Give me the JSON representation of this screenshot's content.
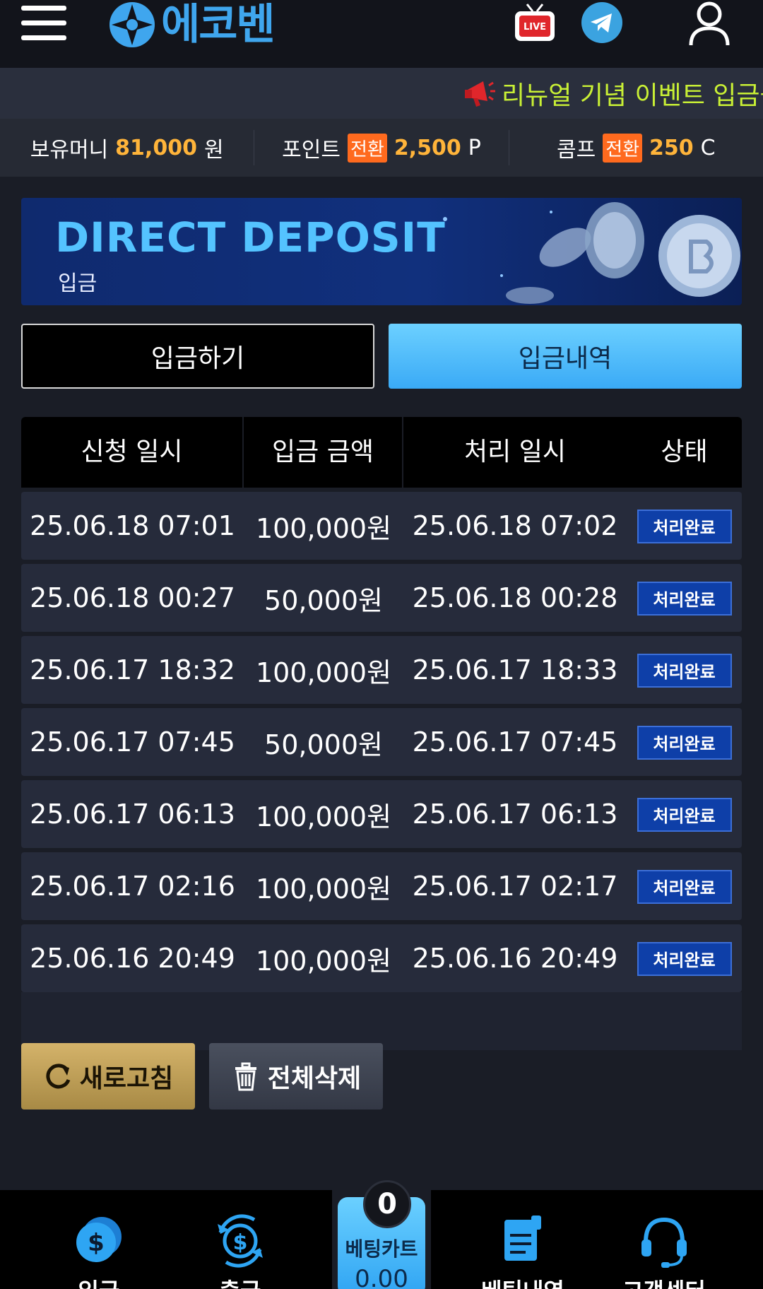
{
  "header": {
    "logo_text": "에코벤",
    "live_label": "LIVE"
  },
  "ticker": {
    "text": "리뉴얼 기념 이벤트 입금플"
  },
  "balance": {
    "money_label": "보유머니",
    "money_value": "81,000",
    "money_unit": "원",
    "point_label": "포인트",
    "point_convert": "전환",
    "point_value": "2,500",
    "point_unit": "P",
    "comp_label": "콤프",
    "comp_convert": "전환",
    "comp_value": "250",
    "comp_unit": "C"
  },
  "banner": {
    "title": "DIRECT DEPOSIT",
    "subtitle": "입금"
  },
  "tabs": {
    "deposit": "입금하기",
    "history": "입금내역"
  },
  "table": {
    "headers": [
      "신청 일시",
      "입금 금액",
      "처리 일시",
      "상태"
    ],
    "rows": [
      {
        "requested": "25.06.18 07:01",
        "amount": "100,000원",
        "processed": "25.06.18 07:02",
        "status": "처리완료"
      },
      {
        "requested": "25.06.18 00:27",
        "amount": "50,000원",
        "processed": "25.06.18 00:28",
        "status": "처리완료"
      },
      {
        "requested": "25.06.17 18:32",
        "amount": "100,000원",
        "processed": "25.06.17 18:33",
        "status": "처리완료"
      },
      {
        "requested": "25.06.17 07:45",
        "amount": "50,000원",
        "processed": "25.06.17 07:45",
        "status": "처리완료"
      },
      {
        "requested": "25.06.17 06:13",
        "amount": "100,000원",
        "processed": "25.06.17 06:13",
        "status": "처리완료"
      },
      {
        "requested": "25.06.17 02:16",
        "amount": "100,000원",
        "processed": "25.06.17 02:17",
        "status": "처리완료"
      },
      {
        "requested": "25.06.16 20:49",
        "amount": "100,000원",
        "processed": "25.06.16 20:49",
        "status": "처리완료"
      }
    ]
  },
  "actions": {
    "refresh": "새로고침",
    "delete_all": "전체삭제"
  },
  "bottom_nav": {
    "deposit": "입금",
    "withdraw": "출금",
    "bet_cart_title": "베팅카트",
    "bet_cart_count": "0",
    "bet_cart_value": "0.00",
    "bet_history": "베팅내역",
    "support": "고객센터"
  },
  "colors": {
    "accent": "#3aaaf6",
    "highlight": "#ffb43a",
    "ticker": "#c9f035",
    "badge": "#ff6a1e",
    "status": "#0e3fa8"
  },
  "icons": [
    "menu-icon",
    "live-tv-icon",
    "telegram-icon",
    "user-icon",
    "megaphone-icon",
    "refresh-icon",
    "trash-icon",
    "deposit-icon",
    "withdraw-icon",
    "bet-history-icon",
    "support-headset-icon"
  ]
}
